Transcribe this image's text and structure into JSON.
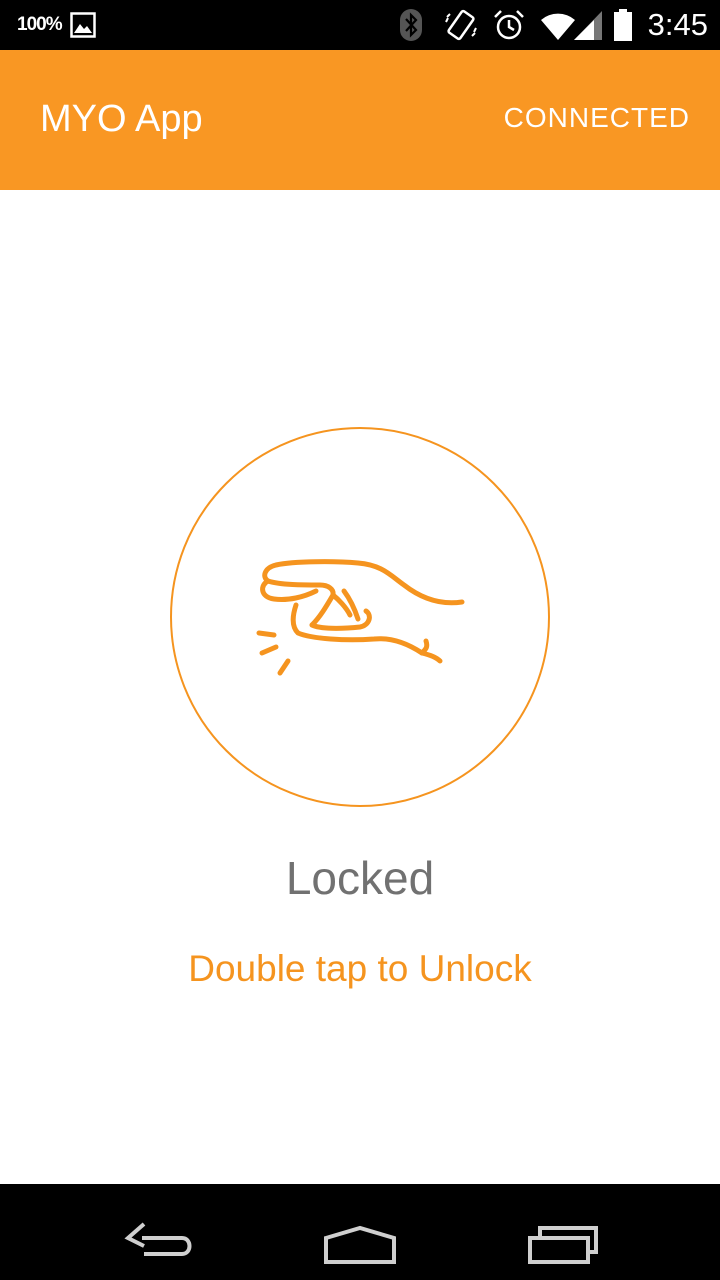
{
  "status_bar": {
    "battery_percent": "100%",
    "time": "3:45",
    "icons": [
      "gallery-icon",
      "bluetooth-icon",
      "vibrate-icon",
      "alarm-icon",
      "wifi-icon",
      "signal-icon",
      "battery-icon"
    ]
  },
  "app_bar": {
    "title": "MYO App",
    "status": "CONNECTED"
  },
  "main": {
    "pose_icon": "double-tap-hand-icon",
    "lock_state": "Locked",
    "hint": "Double tap to Unlock"
  },
  "nav_bar": {
    "buttons": [
      "back-icon",
      "home-icon",
      "recents-icon"
    ]
  },
  "colors": {
    "accent": "#f99723",
    "accent_text": "#f5941f",
    "state_text": "#717171",
    "bar_background": "#000000"
  }
}
